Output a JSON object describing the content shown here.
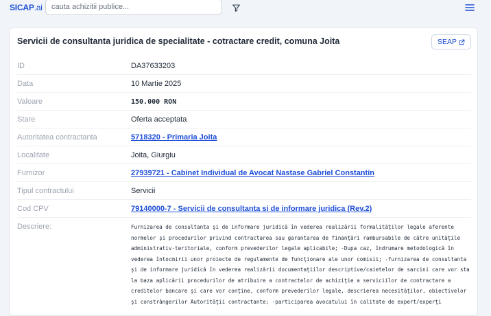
{
  "header": {
    "logo_main": "SICAP",
    "logo_suffix": ".ai",
    "search_placeholder": "cauta achizitii publice..."
  },
  "card": {
    "title": "Servicii de consultanta juridica de specialitate - cotractare credit, comuna Joita",
    "seap_label": "SEAP",
    "fields": {
      "id": {
        "label": "ID",
        "value": "DA37633203"
      },
      "data": {
        "label": "Data",
        "value": "10 Martie 2025"
      },
      "valoare": {
        "label": "Valoare",
        "value": "150.000 RON"
      },
      "stare": {
        "label": "Stare",
        "value": "Oferta acceptata"
      },
      "autoritate": {
        "label": "Autoritatea contractanta",
        "value": "5718320 - Primaria Joita"
      },
      "localitate": {
        "label": "Localitate",
        "value": "Joita, Giurgiu"
      },
      "furnizor": {
        "label": "Furnizor",
        "value": "27939721 - Cabinet Individual de Avocat Nastase Gabriel Constantin"
      },
      "tip": {
        "label": "Tipul contractului",
        "value": "Servicii"
      },
      "cpv": {
        "label": "Cod CPV",
        "value": "79140000-7 - Servicii de consultanta si de informare juridica (Rev.2)"
      },
      "descriere": {
        "label": "Descriere:",
        "value": "Furnizarea de consultanta şi de informare juridică în vederea realizării formalităţilor legale aferente normelor şi procedurilor privind contractarea sau garantarea de finanţări rambursabile de către unităţile administrativ-teritoriale, conform prevederilor legale aplicabile; -Dupa caz, îndrumare metodologică în vederea întocmirii unor proiecte de regulamente de funcţionare ale unor comisii; -furnizarea de consultanta şi de informare juridică în vederea realizării documentaţiilor descriptive/caietelor de sarcini care vor sta la baza aplicării procedurilor de atribuire a contractelor de achiziţie a serviciilor de contractare a creditelor bancare şi care vor conţine, conform prevederilor legale, descrierea necesităţilor, obiectivelor şi constrângerilor Autorităţii contractante; -participarea avocatului în calitate de expert/experţi"
      }
    }
  }
}
